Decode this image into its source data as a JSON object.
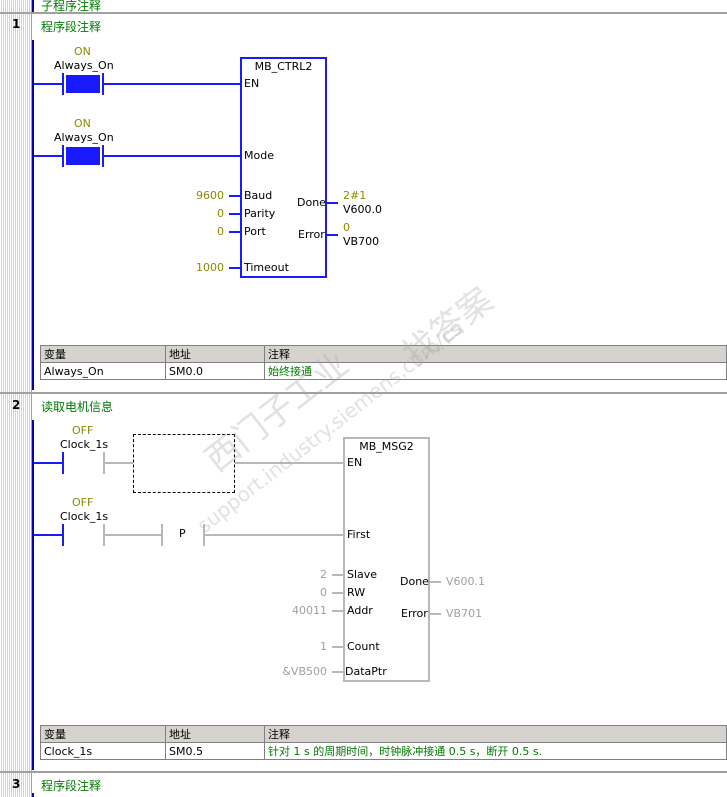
{
  "header": {
    "subroutine_comment": "子程序注释"
  },
  "networks": [
    {
      "number": "1",
      "comment": "程序段注释"
    },
    {
      "number": "2",
      "comment": "读取电机信息"
    },
    {
      "number": "3",
      "comment": "程序段注释"
    }
  ],
  "net1": {
    "contact1": {
      "state": "ON",
      "name": "Always_On"
    },
    "contact2": {
      "state": "ON",
      "name": "Always_On"
    },
    "block": {
      "title": "MB_CTRL2",
      "pins_in": [
        "EN",
        "Mode",
        "Baud",
        "Parity",
        "Port",
        "Timeout"
      ],
      "pins_out": [
        "Done",
        "Error"
      ],
      "baud": "9600",
      "parity": "0",
      "port": "0",
      "timeout": "1000",
      "done_value": "2#1",
      "done_addr": "V600.0",
      "error_value": "0",
      "error_addr": "VB700"
    },
    "table": {
      "headers": [
        "变量",
        "地址",
        "注释"
      ],
      "rows": [
        {
          "var": "Always_On",
          "addr": "SM0.0",
          "comment": "始终接通"
        }
      ]
    }
  },
  "net2": {
    "contact1": {
      "state": "OFF",
      "name": "Clock_1s"
    },
    "contact2": {
      "state": "OFF",
      "name": "Clock_1s"
    },
    "p_label": "P",
    "block": {
      "title": "MB_MSG2",
      "pins_in": [
        "EN",
        "First",
        "Slave",
        "RW",
        "Addr",
        "Count",
        "DataPtr"
      ],
      "pins_out": [
        "Done",
        "Error"
      ],
      "slave": "2",
      "rw": "0",
      "addr": "40011",
      "count": "1",
      "dataptr": "&VB500",
      "done_addr": "V600.1",
      "error_addr": "VB701"
    },
    "table": {
      "headers": [
        "变量",
        "地址",
        "注释"
      ],
      "rows": [
        {
          "var": "Clock_1s",
          "addr": "SM0.5",
          "comment": "针对 1 s 的周期时间，时钟脉冲接通 0.5 s，断开 0.5 s."
        }
      ]
    }
  },
  "watermark": {
    "line1": "西门子工业",
    "line2": "找答案",
    "line3": "support.industry.siemens.com/cs"
  }
}
